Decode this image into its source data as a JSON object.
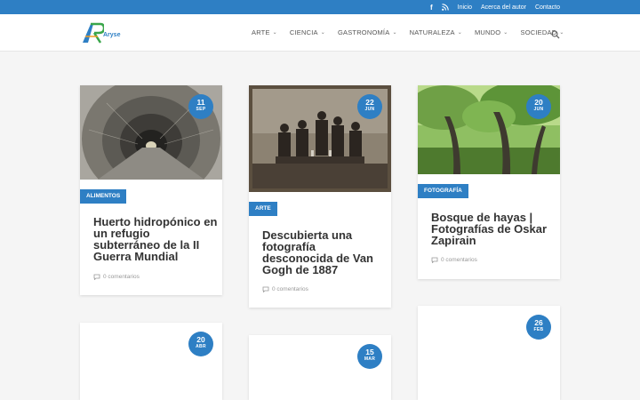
{
  "topbar": {
    "links": [
      "Inicio",
      "Acerca del autor",
      "Contacto"
    ],
    "icons": [
      "facebook-icon",
      "rss-icon"
    ],
    "color": "#2e7fc4"
  },
  "brand": {
    "name": "Aryse"
  },
  "nav": {
    "items": [
      "ARTE",
      "CIENCIA",
      "GASTRONOMÍA",
      "NATURALEZA",
      "MUNDO",
      "SOCIEDAD"
    ]
  },
  "posts": [
    {
      "day": "11",
      "month": "SEP",
      "category": "ALIMENTOS",
      "title": "Huerto hidropónico en un refugio subterráneo de la II Guerra Mundial",
      "comments": "0 comentarios"
    },
    {
      "day": "22",
      "month": "JUN",
      "category": "ARTE",
      "title": "Descubierta una fotografía desconocida de Van Gogh de 1887",
      "comments": "0 comentarios"
    },
    {
      "day": "20",
      "month": "JUN",
      "category": "FOTOGRAFÍA",
      "title": "Bosque de hayas | Fotografías de Oskar Zapirain",
      "comments": "0 comentarios"
    },
    {
      "day": "20",
      "month": "ABR"
    },
    {
      "day": "15",
      "month": "MAR"
    },
    {
      "day": "26",
      "month": "FEB"
    }
  ]
}
